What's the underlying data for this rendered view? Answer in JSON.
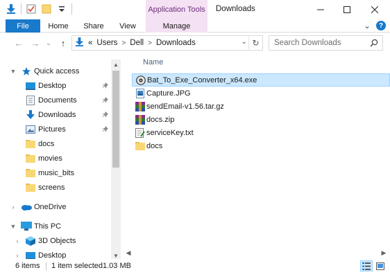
{
  "window": {
    "title": "Downloads",
    "context_tab": "Application Tools",
    "controls": {
      "minimize": "—",
      "maximize": "☐",
      "close": "✕"
    }
  },
  "ribbon": {
    "tabs": [
      "File",
      "Home",
      "Share",
      "View",
      "Manage"
    ],
    "help": "?",
    "collapse": "⌄"
  },
  "addressbar": {
    "back": "←",
    "forward": "→",
    "recent": "⌄",
    "up": "↑",
    "overflow": "«",
    "crumbs": [
      "Users",
      "Dell",
      "Downloads"
    ],
    "dropdown": "⌄",
    "refresh": "↻",
    "search_placeholder": "Search Downloads"
  },
  "navpane": {
    "quick_access": "Quick access",
    "pinned": [
      {
        "label": "Desktop",
        "icon": "desktop-icon"
      },
      {
        "label": "Documents",
        "icon": "documents-icon"
      },
      {
        "label": "Downloads",
        "icon": "downloads-icon"
      },
      {
        "label": "Pictures",
        "icon": "pictures-icon"
      }
    ],
    "folders": [
      "docs",
      "movies",
      "music_bits",
      "screens"
    ],
    "onedrive": "OneDrive",
    "this_pc": "This PC",
    "pc_items": [
      "3D Objects",
      "Desktop"
    ]
  },
  "content": {
    "column_name": "Name",
    "files": [
      {
        "name": "Bat_To_Exe_Converter_x64.exe",
        "icon": "exe-icon",
        "selected": true
      },
      {
        "name": "Capture.JPG",
        "icon": "image-file-icon",
        "selected": false
      },
      {
        "name": "sendEmail-v1.56.tar.gz",
        "icon": "archive-icon",
        "selected": false
      },
      {
        "name": "docs.zip",
        "icon": "archive-icon",
        "selected": false
      },
      {
        "name": "serviceKey.txt",
        "icon": "text-file-icon",
        "selected": false
      },
      {
        "name": "docs",
        "icon": "folder-icon",
        "selected": false
      }
    ]
  },
  "status": {
    "item_count": "6 items",
    "selection": "1 item selected",
    "size": "1.03 MB"
  },
  "colors": {
    "accent": "#1979ca",
    "context_tab": "#f4e1f4",
    "selection": "#cce8ff",
    "folder": "#f8d775"
  }
}
